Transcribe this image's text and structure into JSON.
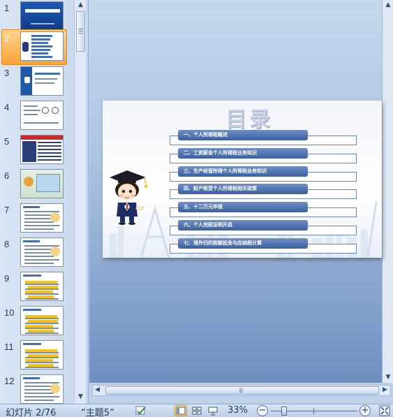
{
  "thumbnails": [
    {
      "number": "1",
      "selected": false,
      "style": "cover"
    },
    {
      "number": "2",
      "selected": true,
      "style": "toc"
    },
    {
      "number": "3",
      "selected": false,
      "style": "section"
    },
    {
      "number": "4",
      "selected": false,
      "style": "diagram"
    },
    {
      "number": "5",
      "selected": false,
      "style": "table"
    },
    {
      "number": "6",
      "selected": false,
      "style": "image"
    },
    {
      "number": "7",
      "selected": false,
      "style": "text"
    },
    {
      "number": "8",
      "selected": false,
      "style": "text"
    },
    {
      "number": "9",
      "selected": false,
      "style": "bullets"
    },
    {
      "number": "10",
      "selected": false,
      "style": "bullets"
    },
    {
      "number": "11",
      "selected": false,
      "style": "bullets"
    },
    {
      "number": "12",
      "selected": false,
      "style": "text"
    }
  ],
  "slide": {
    "title": "目录",
    "toc_items": [
      "一、个人所得税概述",
      "二、工资薪金个人所得税业务知识",
      "三、生产经营所得个人所得税业务知识",
      "四、财产租赁个人所得税相关政策",
      "五、十二万元申报",
      "六、个人完税证明开具",
      "七、境外归的税额抵免与应纳税计算"
    ]
  },
  "status_bar": {
    "slide_indicator": "幻灯片 2/76",
    "theme": "“主题5”",
    "zoom": "33%",
    "zoom_out": "−",
    "zoom_in": "+"
  },
  "colors": {
    "accent": "#3b5fa0",
    "selected_thumb": "#f6a43b",
    "pane_bg": "#d8e4f3"
  }
}
